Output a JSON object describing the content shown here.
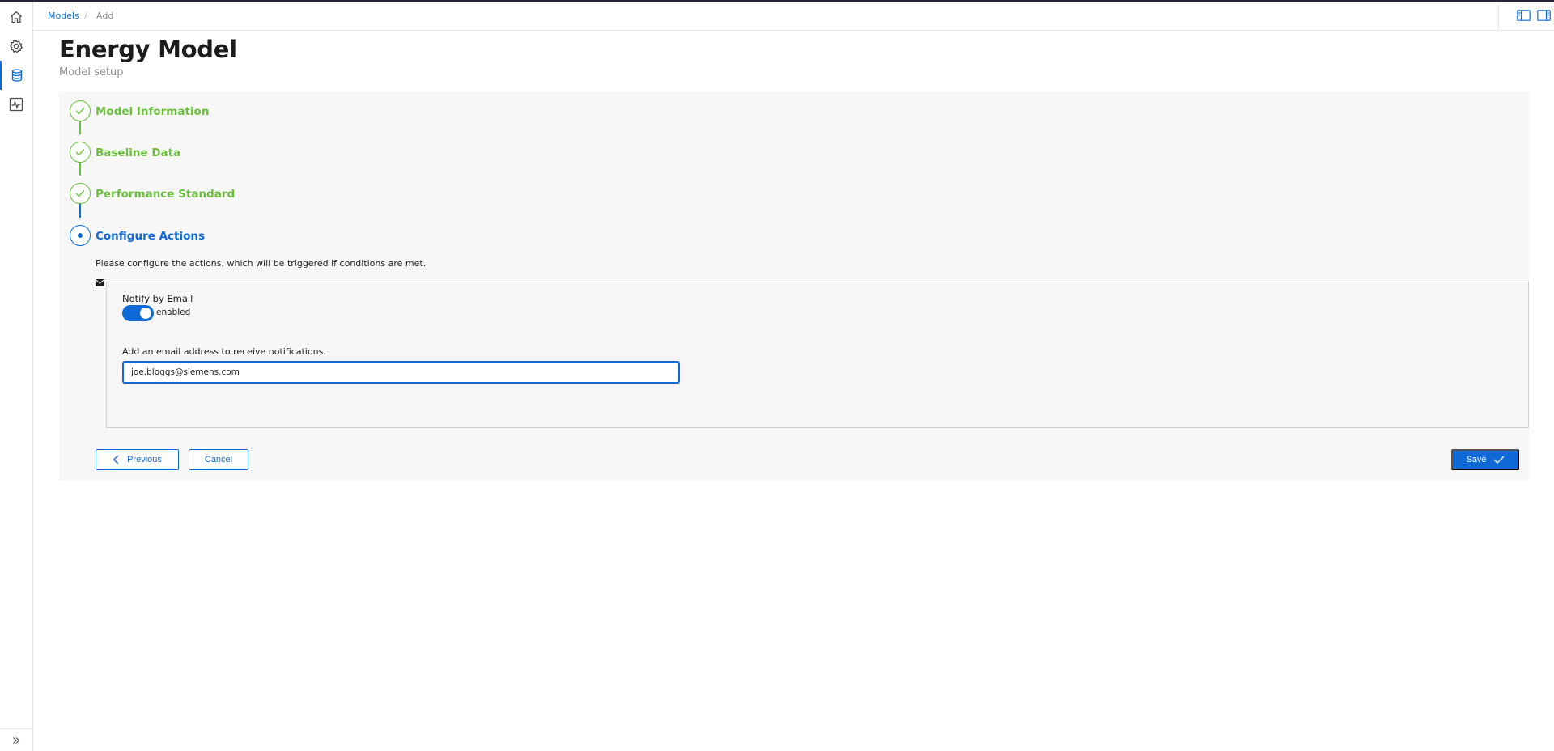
{
  "breadcrumb": {
    "parent": "Models",
    "separator": "/",
    "current": "Add"
  },
  "page": {
    "title": "Energy Model",
    "subtitle": "Model setup"
  },
  "steps": [
    {
      "label": "Model Information",
      "state": "done"
    },
    {
      "label": "Baseline Data",
      "state": "done"
    },
    {
      "label": "Performance Standard",
      "state": "done"
    },
    {
      "label": "Configure Actions",
      "state": "current"
    }
  ],
  "configure": {
    "instruction": "Please configure the actions, which will be triggered if conditions are met.",
    "notify_label": "Notify by Email",
    "toggle_state": "enabled",
    "email_label": "Add an email address to receive notifications.",
    "email_value": "joe.bloggs@siemens.com"
  },
  "buttons": {
    "previous": "Previous",
    "cancel": "Cancel",
    "save": "Save"
  },
  "colors": {
    "primary": "#0f6ad8",
    "success": "#6cbf3e"
  },
  "icons": {
    "rail": [
      "home-icon",
      "gear-icon",
      "database-icon",
      "activity-chart-icon"
    ],
    "rail_bottom": "double-chevron-right-icon",
    "header": [
      "left-panel-icon",
      "right-panel-icon"
    ]
  }
}
